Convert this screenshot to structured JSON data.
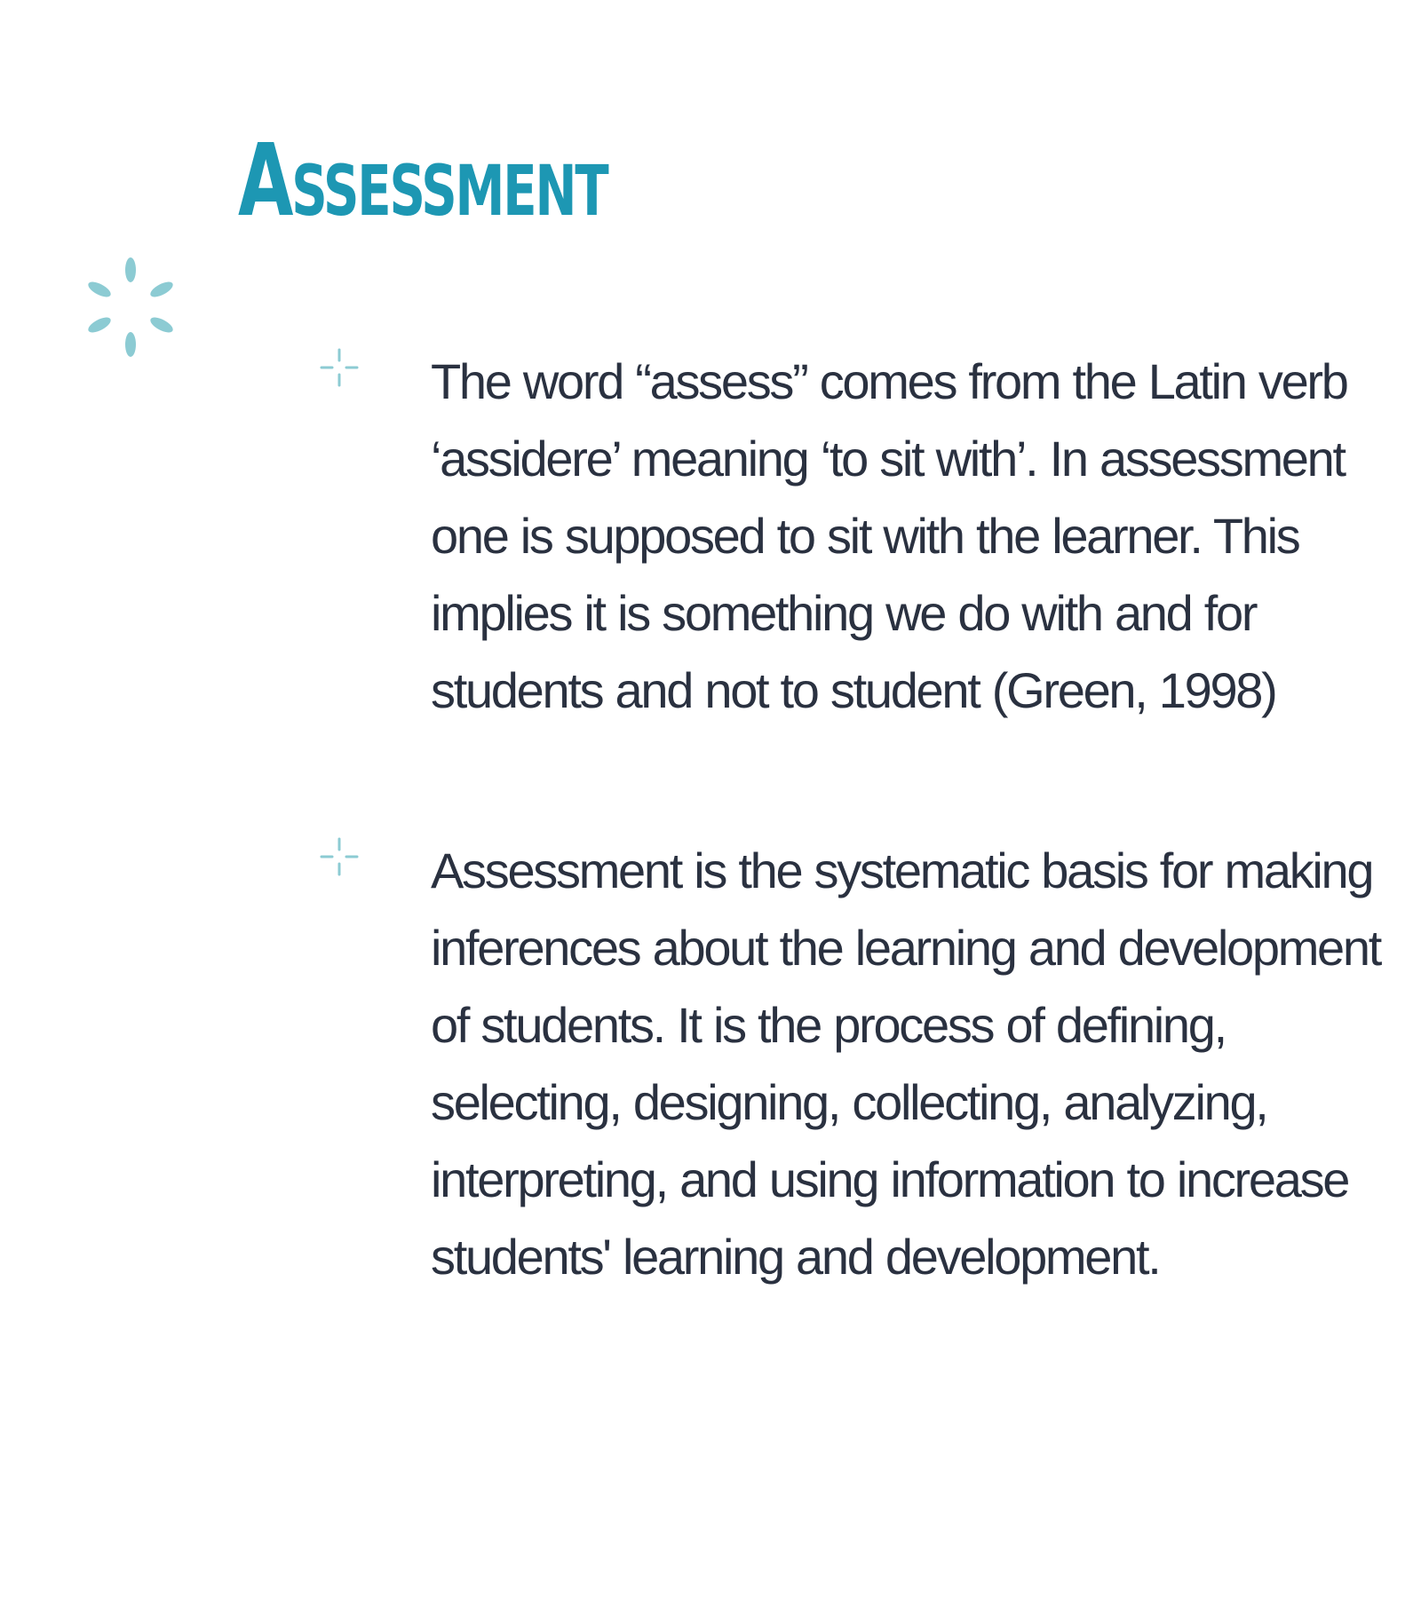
{
  "slide": {
    "title": "Assessment",
    "decoration_icon": "sparkle-burst-icon",
    "bullet_icon": "sparkle-cross-icon",
    "colors": {
      "title": "#1d97b3",
      "accent": "#8ccbd3",
      "text": "#2a3140",
      "background": "#ffffff"
    },
    "bullets": [
      {
        "text": "The word “assess” comes from the Latin verb ‘assidere’ meaning ‘to sit with’. In assessment one is supposed to sit with the learner. This implies it is something we do with and for students and not to student (Green, 1998)"
      },
      {
        "text": "Assessment is the systematic basis for making inferences about the learning and development of students. It is the process of defining, selecting, designing, collecting, analyzing, interpreting, and using information to increase students' learning and development."
      }
    ]
  }
}
